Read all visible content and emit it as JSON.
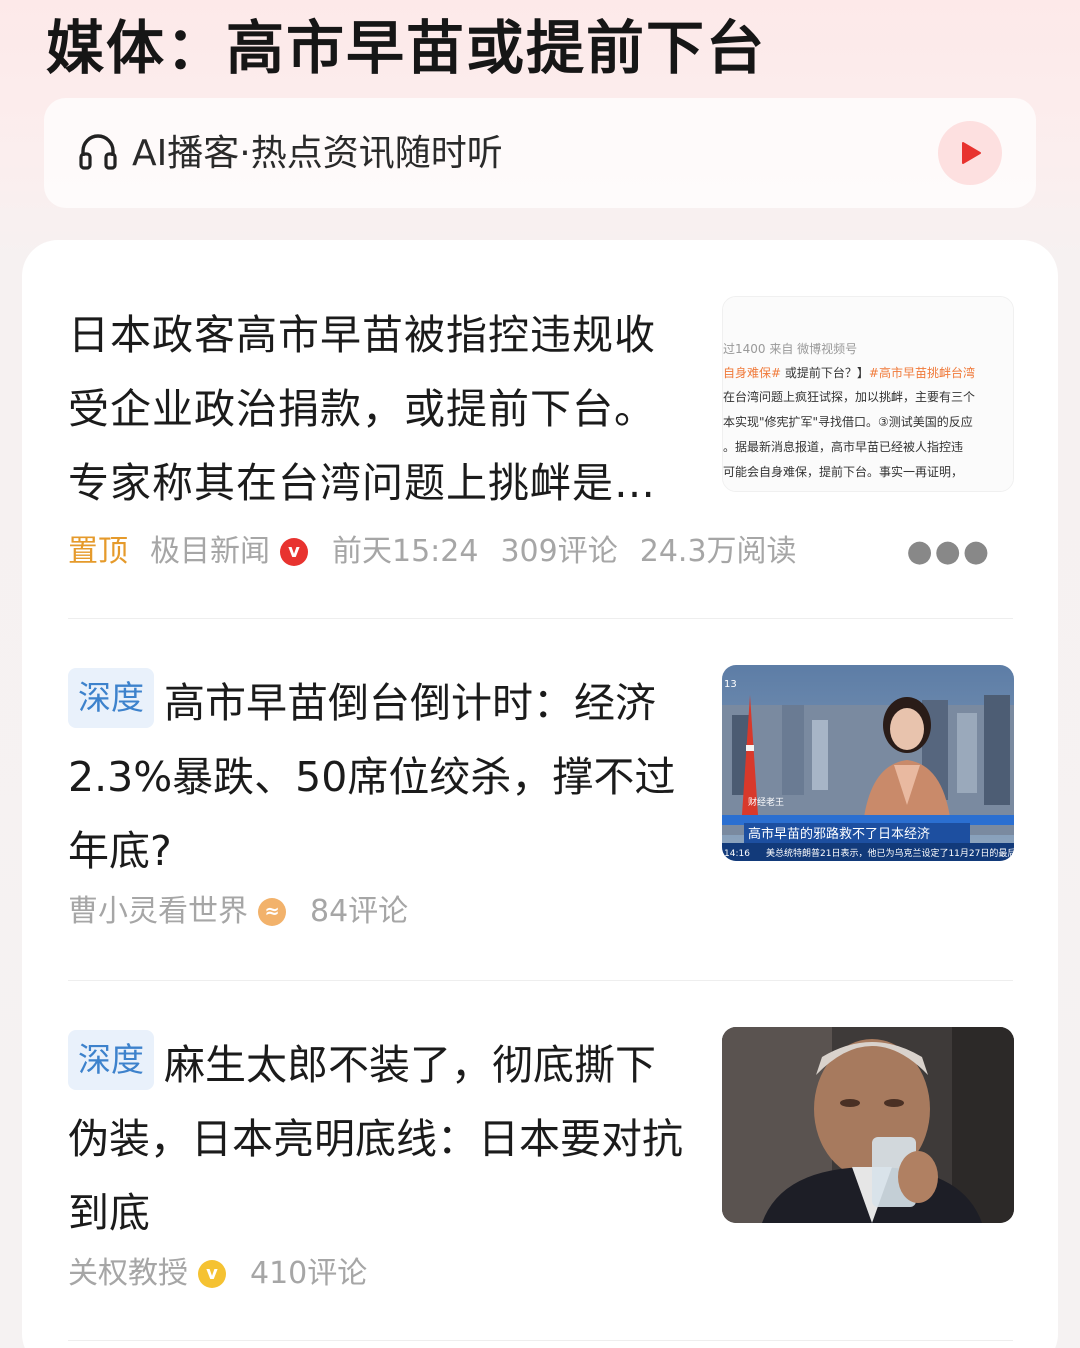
{
  "header": {
    "title": "媒体：高市早苗或提前下台"
  },
  "podcast": {
    "icon": "headphone-icon",
    "label": "AI播客·热点资讯随时听",
    "play_icon": "play-icon"
  },
  "items": [
    {
      "tag": "",
      "title": "日本政客高市早苗被指控违规收受企业政治捐款，或提前下台。专家称其在台湾问题上挑衅是…",
      "meta": {
        "pin": "置顶",
        "source": "极目新闻",
        "time": "前天15:24",
        "comments": "309评论",
        "reads": "24.3万阅读"
      },
      "thumb": {
        "line1": "过1400  来自 微博视频号",
        "line2a": "自身难保#",
        "line2b": " 或提前下台？】",
        "line2c": "#高市早苗挑衅台湾",
        "line3": "在台湾问题上疯狂试探，加以挑衅，主要有三个",
        "line4": "本实现\"修宪扩军\"寻找借口。③测试美国的反应",
        "line5": "。据最新消息报道，高市早苗已经被人指控违",
        "line6": "可能会自身难保，提前下台。事实一再证明，"
      }
    },
    {
      "tag": "深度",
      "title": "高市早苗倒台倒计时：经济2.3%暴跌、50席位绞杀，撑不过年底?",
      "meta": {
        "source": "曹小灵看世界",
        "comments": "84评论"
      },
      "thumb": {
        "caption": "高市早苗的邪路救不了日本经济",
        "ticker": "美总统特朗普21日表示，他已为乌克兰设定了11月27日的最后",
        "label": "财经老王",
        "time": "14:16",
        "channel": "13"
      }
    },
    {
      "tag": "深度",
      "title": "麻生太郎不装了，彻底撕下伪装，日本亮明底线：日本要对抗到底",
      "meta": {
        "source": "关权教授",
        "comments": "410评论"
      }
    }
  ],
  "colors": {
    "accent_red": "#e8332f",
    "tag_blue": "#3d82cc",
    "pin_orange": "#e59a2b"
  }
}
